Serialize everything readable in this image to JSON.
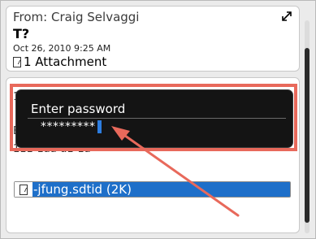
{
  "header": {
    "from_label": "From: Craig Selvaggi",
    "subject": "T?",
    "date": "Oct 26, 2010 9:25 AM",
    "attachment_count_label": "1 Attachment"
  },
  "body": {
    "bg_line_1": "1",
    "bg_line_2": "E",
    "bg_line_3": "111-1aa-a1-1a"
  },
  "password_dialog": {
    "title": "Enter password",
    "masked_value": "*********"
  },
  "attachment": {
    "file_label": "-jfung.sdtid (2K)"
  },
  "colors": {
    "highlight": "#e8695b",
    "selection": "#1e6fc9",
    "cursor": "#2d7de0"
  }
}
